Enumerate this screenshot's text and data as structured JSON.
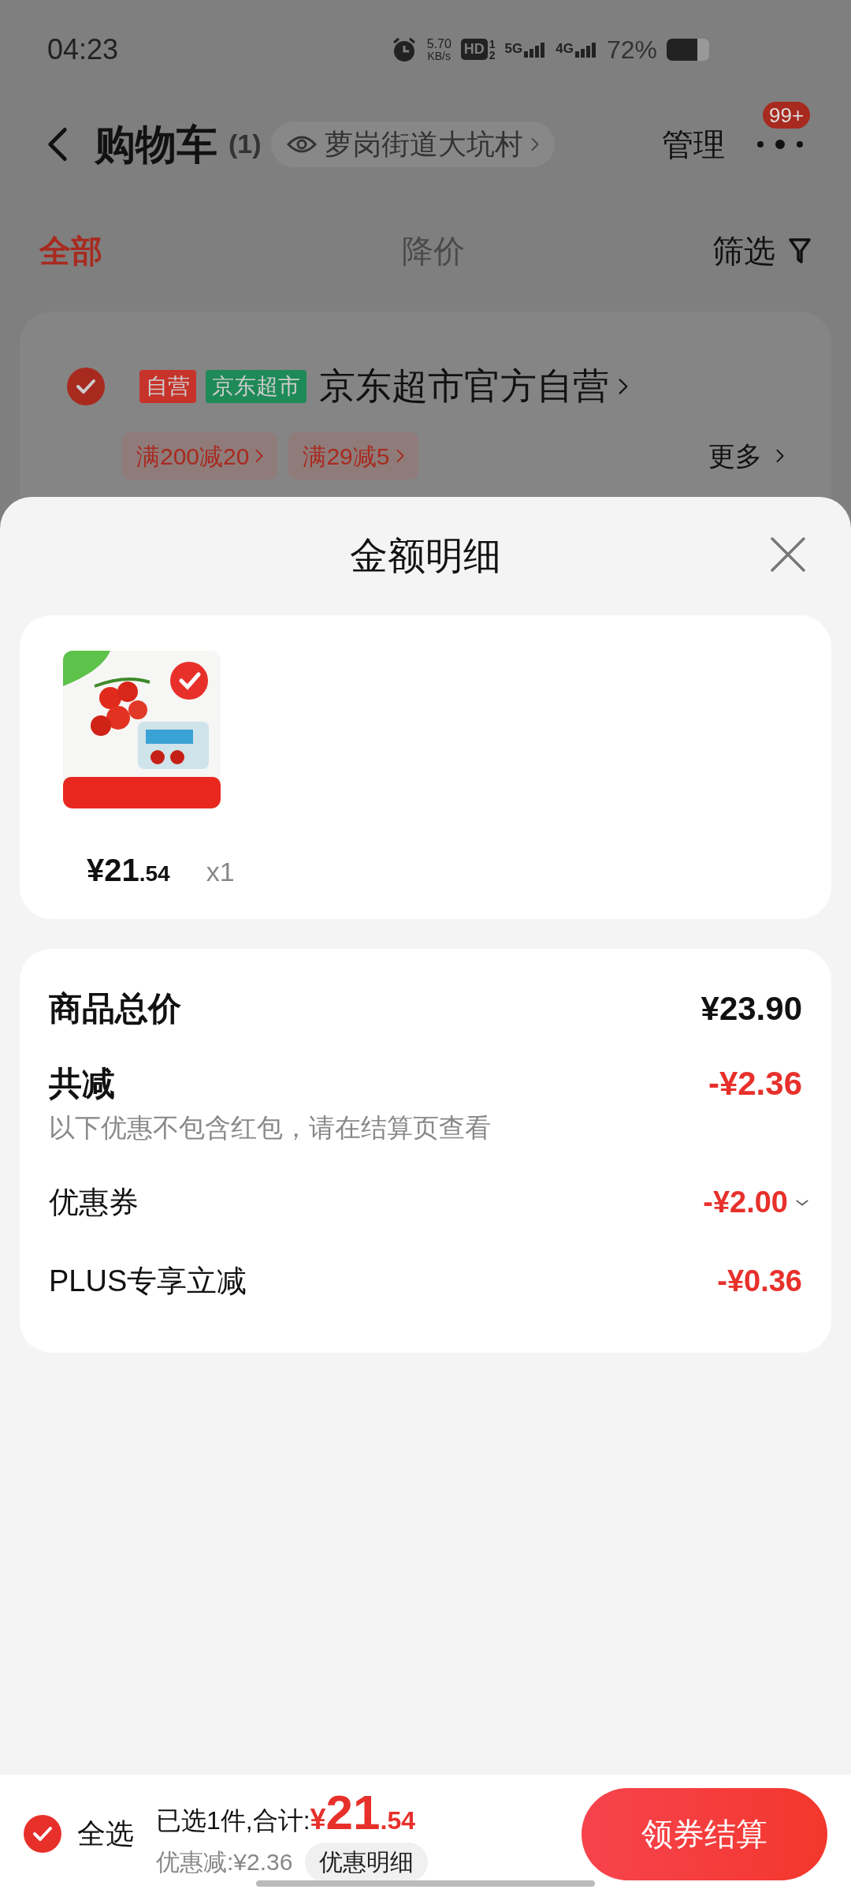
{
  "status_bar": {
    "time": "04:23",
    "speed_value": "5.70",
    "speed_unit": "KB/s",
    "hd": "HD",
    "hd_sims": [
      "1",
      "2"
    ],
    "networks": [
      "5G",
      "4G"
    ],
    "battery": "72%"
  },
  "header": {
    "title": "购物车",
    "count": "(1)",
    "location": "萝岗街道大坑村",
    "manage": "管理",
    "badge": "99+"
  },
  "tabs": [
    {
      "label": "全部",
      "selected": true
    },
    {
      "label": "降价",
      "selected": false
    }
  ],
  "filter": "筛选",
  "store": {
    "checked": true,
    "tags": [
      {
        "label": "自营",
        "color": "#c7332a"
      },
      {
        "label": "京东超市",
        "color": "#1e8a57"
      }
    ],
    "name": "京东超市官方自营",
    "coupons": [
      "满200减20",
      "满29减5"
    ],
    "more": "更多"
  },
  "sheet": {
    "title": "金额明细",
    "product": {
      "kind": "picture",
      "price_main": "¥21",
      "price_decimal": ".54",
      "quantity": "x1"
    },
    "summary": [
      {
        "kind": "total",
        "label": "商品总价",
        "value": "¥23.90"
      },
      {
        "kind": "discount_total",
        "label": "共减",
        "value": "-¥2.36",
        "note": "以下优惠不包含红包，请在结算页查看"
      },
      {
        "kind": "discount",
        "label": "优惠券",
        "value": "-¥2.00",
        "expandable": true
      },
      {
        "kind": "discount",
        "label": "PLUS专享立减",
        "value": "-¥0.36",
        "expandable": false
      }
    ]
  },
  "bottom_bar": {
    "select_all": {
      "label": "全选",
      "checked": true
    },
    "summary_label": "已选1件,合计:",
    "currency": "¥",
    "total_main": "21",
    "total_decimal": ".54",
    "discount": "优惠减:¥2.36",
    "detail_button": "优惠明细",
    "checkout": "领券结算"
  }
}
